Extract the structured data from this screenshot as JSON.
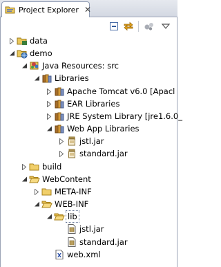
{
  "view": {
    "title": "Project Explorer",
    "close_glyph": "✕"
  },
  "toolbar": {
    "buttons": [
      {
        "name": "collapse-all-icon"
      },
      {
        "name": "link-with-editor-icon"
      },
      {
        "name": "view-settings-icon"
      },
      {
        "name": "view-menu-chevron-icon"
      }
    ]
  },
  "tree": {
    "nodes": [
      {
        "label": "data",
        "depth": 0,
        "state": "collapsed",
        "icon": "project-icon"
      },
      {
        "label": "demo",
        "depth": 0,
        "state": "expanded",
        "icon": "web-project-icon"
      },
      {
        "label": "Java Resources: src",
        "depth": 1,
        "state": "expanded",
        "icon": "java-resources-icon"
      },
      {
        "label": "Libraries",
        "depth": 2,
        "state": "expanded",
        "icon": "libraries-icon"
      },
      {
        "label": "Apache Tomcat v6.0 [Apacl",
        "depth": 3,
        "state": "collapsed",
        "icon": "library-icon"
      },
      {
        "label": "EAR Libraries",
        "depth": 3,
        "state": "collapsed",
        "icon": "library-icon"
      },
      {
        "label": "JRE System Library [jre1.6.0_",
        "depth": 3,
        "state": "collapsed",
        "icon": "library-icon"
      },
      {
        "label": "Web App Libraries",
        "depth": 3,
        "state": "expanded",
        "icon": "library-icon"
      },
      {
        "label": "jstl.jar",
        "depth": 4,
        "state": "collapsed",
        "icon": "jar-icon"
      },
      {
        "label": "standard.jar",
        "depth": 4,
        "state": "collapsed",
        "icon": "jar-icon"
      },
      {
        "label": "build",
        "depth": 1,
        "state": "collapsed",
        "icon": "folder-icon"
      },
      {
        "label": "WebContent",
        "depth": 1,
        "state": "expanded",
        "icon": "folder-open-icon"
      },
      {
        "label": "META-INF",
        "depth": 2,
        "state": "collapsed",
        "icon": "folder-icon"
      },
      {
        "label": "WEB-INF",
        "depth": 2,
        "state": "expanded",
        "icon": "folder-open-icon"
      },
      {
        "label": "lib",
        "depth": 3,
        "state": "expanded",
        "icon": "folder-open-icon",
        "selected": true
      },
      {
        "label": "jstl.jar",
        "depth": 4,
        "state": "leaf",
        "icon": "jar-file-icon"
      },
      {
        "label": "standard.jar",
        "depth": 4,
        "state": "leaf",
        "icon": "jar-file-icon"
      },
      {
        "label": "web.xml",
        "depth": 3,
        "state": "leaf",
        "icon": "xml-file-icon"
      }
    ]
  }
}
